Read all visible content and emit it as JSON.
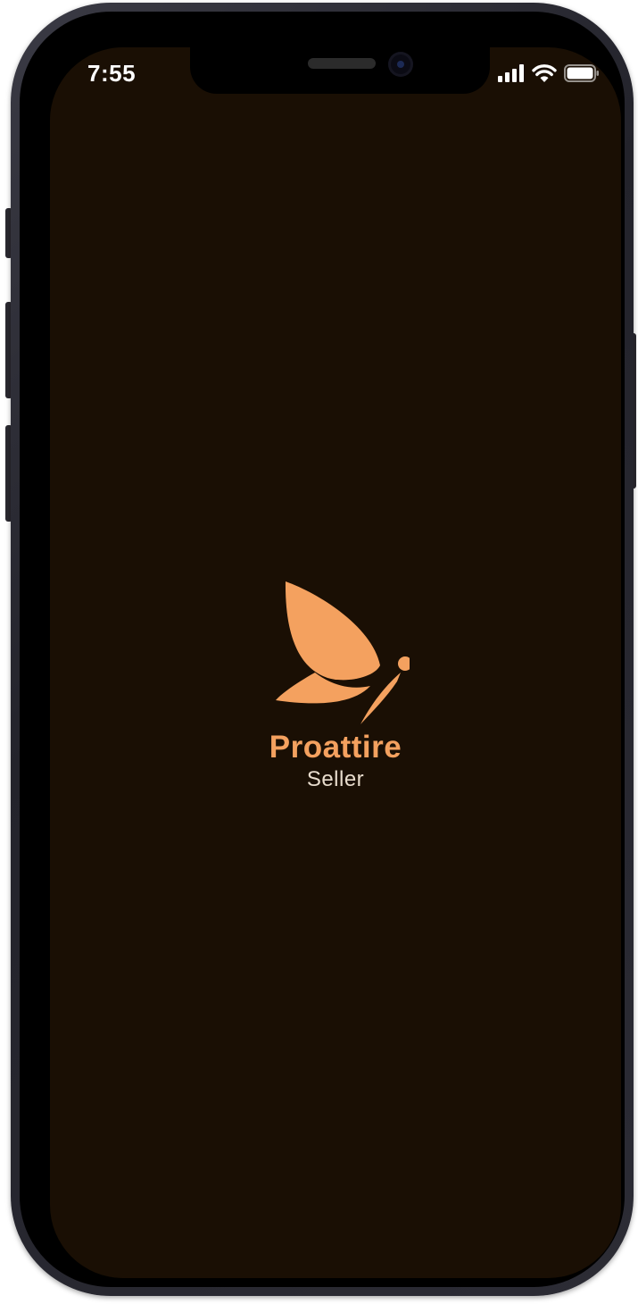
{
  "status_bar": {
    "time": "7:55",
    "icons": [
      "cellular-signal-icon",
      "wifi-icon",
      "battery-icon"
    ]
  },
  "splash": {
    "logo_icon": "butterfly-logo-icon",
    "brand_name": "Proattire",
    "brand_subtitle": "Seller"
  },
  "colors": {
    "background": "#1a0f04",
    "accent": "#f4a15f",
    "subtitle": "#e8dccd",
    "frame": "#2c2c35"
  }
}
